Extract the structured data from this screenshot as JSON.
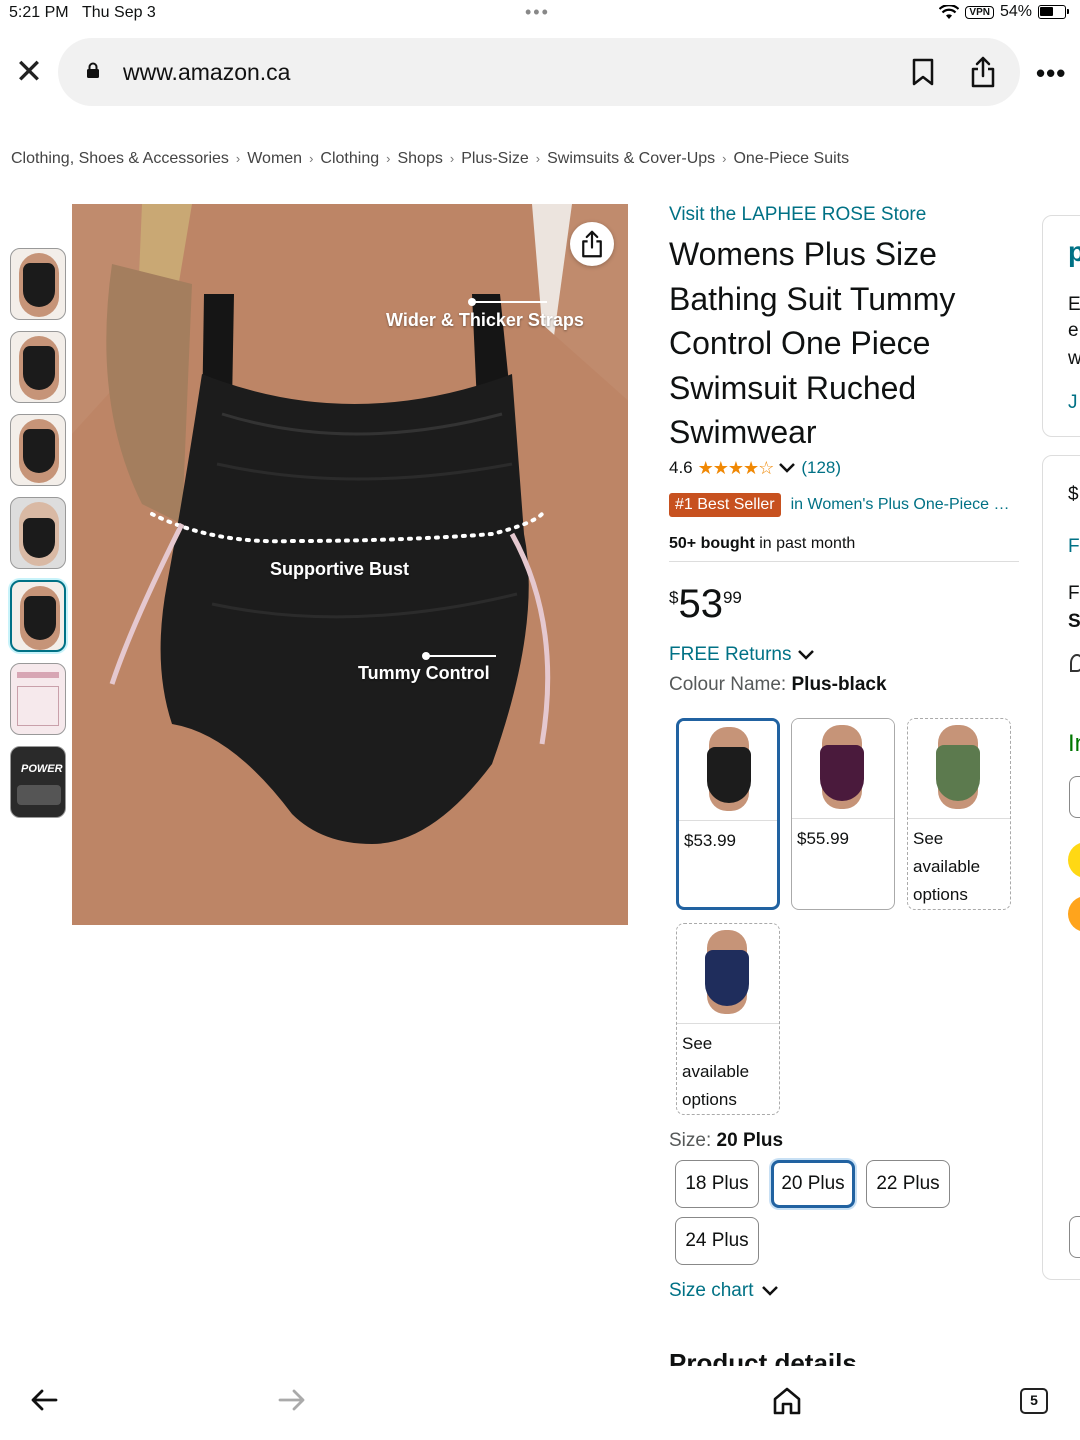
{
  "status": {
    "time": "5:21 PM",
    "date": "Thu Sep 3",
    "battery": "54%",
    "vpn": "VPN"
  },
  "browser": {
    "url": "www.amazon.ca",
    "tabs_count": "5"
  },
  "breadcrumb": [
    "Clothing, Shoes & Accessories",
    "Women",
    "Clothing",
    "Shops",
    "Plus-Size",
    "Swimsuits & Cover-Ups",
    "One-Piece Suits"
  ],
  "image": {
    "callouts": {
      "straps": "Wider & Thicker Straps",
      "bust": "Supportive Bust",
      "tummy": "Tummy Control"
    },
    "thumb7_text": "POWER"
  },
  "product": {
    "store": "Visit the LAPHEE ROSE Store",
    "title": "Womens Plus Size Bathing Suit Tummy Control One Piece Swimsuit Ruched Swimwear",
    "rating": "4.6",
    "stars": "★★★★☆",
    "rating_count": "(128)",
    "best_seller": "#1 Best Seller",
    "best_seller_category": "in Women's Plus One-Piece Swimsuits",
    "bought_bold": "50+ bought",
    "bought_rest": " in past month",
    "price_currency": "$",
    "price_whole": "53",
    "price_fraction": "99",
    "returns": "FREE Returns",
    "colour_label": "Colour Name: ",
    "colour_value": "Plus-black"
  },
  "colours": [
    {
      "name": "black",
      "color": "#1c1c1c",
      "text": "$53.99"
    },
    {
      "name": "purple",
      "color": "#4a1a3c",
      "text": "$55.99"
    },
    {
      "name": "green",
      "color": "#5c7a4e",
      "text": "See available options"
    },
    {
      "name": "navy",
      "color": "#1f2d5c",
      "text": "See available options"
    }
  ],
  "size": {
    "label": "Size: ",
    "value": "20 Plus",
    "options": [
      "18 Plus",
      "20 Plus",
      "22 Plus",
      "24 Plus"
    ],
    "chart": "Size chart"
  },
  "section_heading": "Product details",
  "side_fragments": [
    "p",
    "E",
    "e",
    "w",
    "J",
    "$",
    "F",
    "F",
    "S",
    "In"
  ]
}
